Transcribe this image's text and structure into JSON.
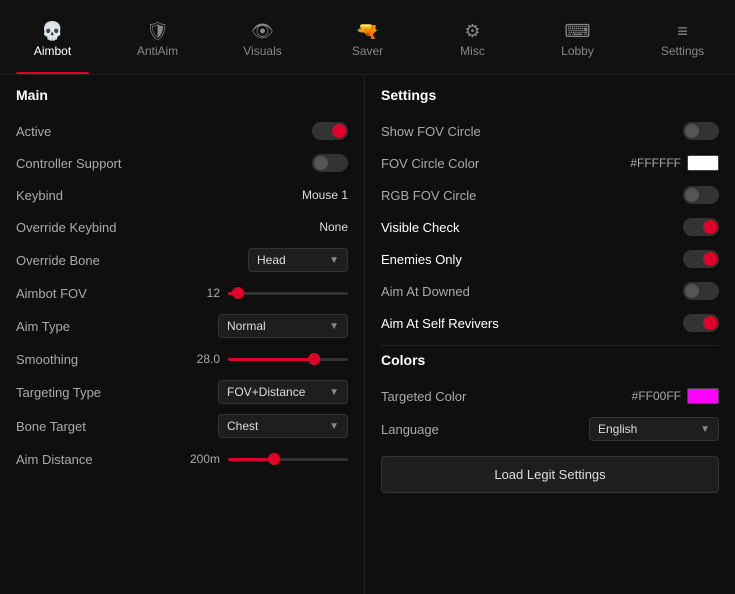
{
  "nav": {
    "items": [
      {
        "id": "aimbot",
        "label": "Aimbot",
        "icon": "💀",
        "active": true
      },
      {
        "id": "antiAim",
        "label": "AntiAim",
        "icon": "🛡",
        "active": false
      },
      {
        "id": "visuals",
        "label": "Visuals",
        "icon": "👁",
        "active": false
      },
      {
        "id": "saver",
        "label": "Saver",
        "icon": "🔫",
        "active": false
      },
      {
        "id": "misc",
        "label": "Misc",
        "icon": "⚙",
        "active": false
      },
      {
        "id": "lobby",
        "label": "Lobby",
        "icon": "⌨",
        "active": false
      },
      {
        "id": "settings",
        "label": "Settings",
        "icon": "≡",
        "active": false
      }
    ]
  },
  "left": {
    "section": "Main",
    "rows": [
      {
        "id": "active",
        "label": "Active",
        "type": "toggle",
        "state": "on"
      },
      {
        "id": "controllerSupport",
        "label": "Controller Support",
        "type": "toggle",
        "state": "off"
      },
      {
        "id": "keybind",
        "label": "Keybind",
        "type": "keybind",
        "value": "Mouse 1"
      },
      {
        "id": "overrideKeybind",
        "label": "Override Keybind",
        "type": "keybind",
        "value": "None"
      },
      {
        "id": "overrideBone",
        "label": "Override Bone",
        "type": "dropdown",
        "value": "Head"
      },
      {
        "id": "aimbotFov",
        "label": "Aimbot FOV",
        "type": "slider",
        "numVal": "12",
        "fillPct": 8
      },
      {
        "id": "aimType",
        "label": "Aim Type",
        "type": "dropdown",
        "value": "Normal"
      },
      {
        "id": "smoothing",
        "label": "Smoothing",
        "type": "slider",
        "numVal": "28.0",
        "fillPct": 72
      },
      {
        "id": "targetingType",
        "label": "Targeting Type",
        "type": "dropdown",
        "value": "FOV+Distance"
      },
      {
        "id": "boneTarget",
        "label": "Bone Target",
        "type": "dropdown",
        "value": "Chest"
      },
      {
        "id": "aimDistance",
        "label": "Aim Distance",
        "type": "slider",
        "numVal": "200m",
        "fillPct": 38
      }
    ]
  },
  "right": {
    "section": "Settings",
    "rows": [
      {
        "id": "showFovCircle",
        "label": "Show FOV Circle",
        "type": "toggle",
        "state": "off"
      },
      {
        "id": "fovCircleColor",
        "label": "FOV Circle Color",
        "type": "color",
        "hex": "#FFFFFF",
        "color": "#ffffff"
      },
      {
        "id": "rgbFovCircle",
        "label": "RGB FOV Circle",
        "type": "toggle",
        "state": "off"
      },
      {
        "id": "visibleCheck",
        "label": "Visible Check",
        "type": "toggle",
        "state": "on"
      },
      {
        "id": "enemiesOnly",
        "label": "Enemies Only",
        "type": "toggle",
        "state": "on"
      },
      {
        "id": "aimAtDowned",
        "label": "Aim At Downed",
        "type": "toggle",
        "state": "off"
      },
      {
        "id": "aimAtSelfRevivers",
        "label": "Aim At Self Revivers",
        "type": "toggle",
        "state": "on"
      }
    ],
    "colorsSection": "Colors",
    "colorRows": [
      {
        "id": "targetedColor",
        "label": "Targeted Color",
        "hex": "#FF00FF",
        "color": "#ff00ff"
      },
      {
        "id": "language",
        "label": "Language",
        "type": "dropdown",
        "value": "English"
      }
    ],
    "loadBtn": "Load Legit Settings"
  }
}
